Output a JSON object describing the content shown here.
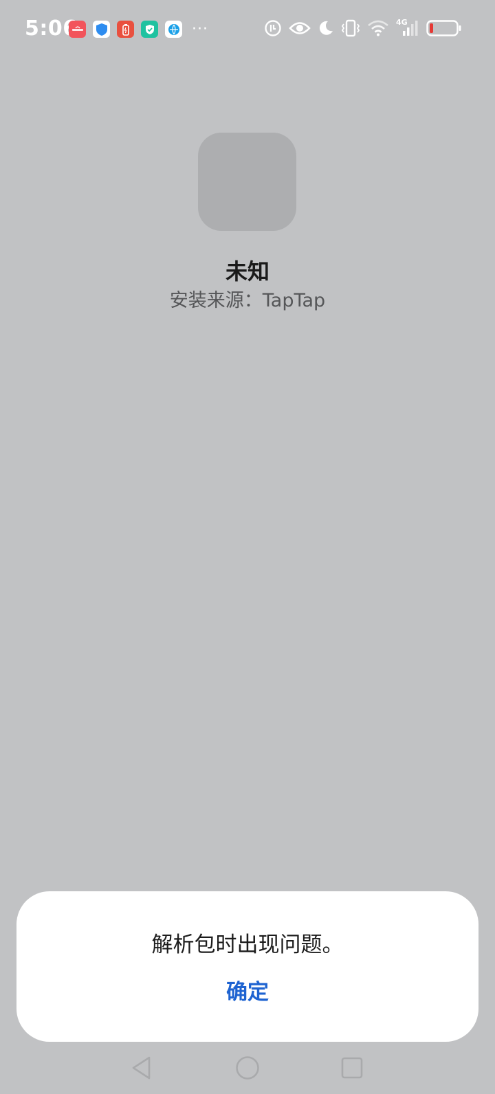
{
  "status_bar": {
    "time": "5:06",
    "more": "···",
    "network": "4G",
    "notifications": [
      {
        "name": "huawei-appgallery-icon",
        "color": "#f2545b"
      },
      {
        "name": "security-shield-icon",
        "color": "#2d8cf0"
      },
      {
        "name": "battery-manager-icon",
        "color": "#e9503f"
      },
      {
        "name": "phone-manager-icon",
        "color": "#1fc2a0"
      },
      {
        "name": "browser-icon",
        "color": "#1aa0e8"
      }
    ]
  },
  "app": {
    "name": "未知",
    "install_source": "安装来源：TapTap"
  },
  "dialog": {
    "message": "解析包时出现问题。",
    "confirm_label": "确定"
  },
  "colors": {
    "background": "#c1c2c4",
    "accent": "#1e63d1",
    "battery_low": "#e53935"
  }
}
